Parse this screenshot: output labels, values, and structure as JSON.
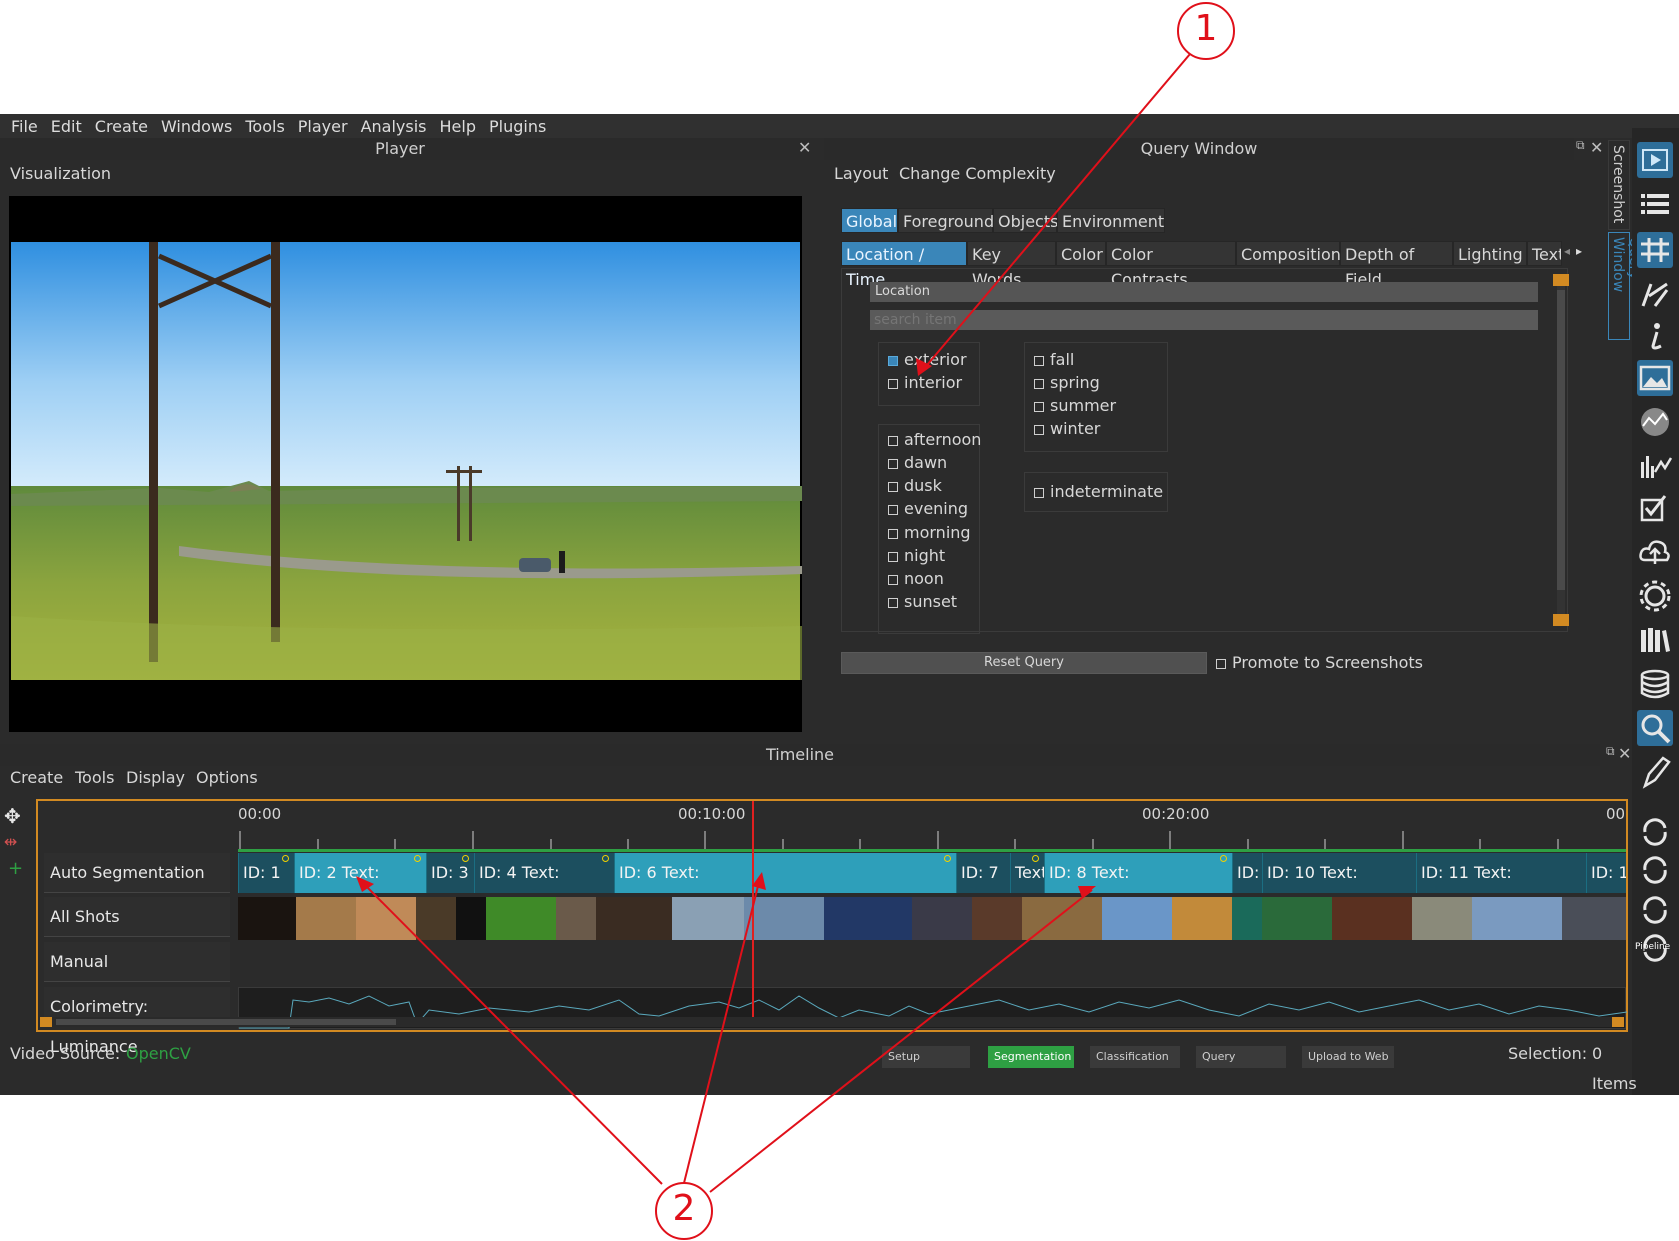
{
  "menu": [
    "File",
    "Edit",
    "Create",
    "Windows",
    "Tools",
    "Player",
    "Analysis",
    "Help",
    "Plugins"
  ],
  "player": {
    "title": "Player",
    "visualization_label": "Visualization"
  },
  "query": {
    "title": "Query Window",
    "menu": [
      "Layout",
      "Change Complexity"
    ],
    "tabs_top": [
      "Global",
      "Foreground",
      "Objects",
      "Environment"
    ],
    "tabs_sub": [
      "Location / Time",
      "Key Words",
      "Color",
      "Color Contrasts",
      "Composition",
      "Depth of Field",
      "Lighting",
      "Text"
    ],
    "location_header": "Location",
    "search_placeholder": "search item",
    "group1": [
      {
        "label": "exterior",
        "checked": true
      },
      {
        "label": "interior",
        "checked": false
      }
    ],
    "group2": [
      {
        "label": "afternoon"
      },
      {
        "label": "dawn"
      },
      {
        "label": "dusk"
      },
      {
        "label": "evening"
      },
      {
        "label": "morning"
      },
      {
        "label": "night"
      },
      {
        "label": "noon"
      },
      {
        "label": "sunset"
      }
    ],
    "group3": [
      {
        "label": "fall"
      },
      {
        "label": "spring"
      },
      {
        "label": "summer"
      },
      {
        "label": "winter"
      }
    ],
    "group4": [
      {
        "label": "indeterminate"
      }
    ],
    "reset_button": "Reset Query",
    "promote_label": "Promote to Screenshots"
  },
  "side_tabs": [
    "Screenshot",
    "Query Window"
  ],
  "timeline": {
    "title": "Timeline",
    "menu": [
      "Create",
      "Tools",
      "Display",
      "Options"
    ],
    "time_labels": [
      "00:00",
      "00:10:00",
      "00:20:00",
      "00"
    ],
    "tracks": [
      "Auto Segmentation",
      "All Shots",
      "Manual",
      "Colorimetry: Luminance"
    ],
    "segments": [
      "ID: 1",
      "ID: 2    Text:",
      "ID: 3",
      "ID: 4     Text:",
      "ID: 6     Text:",
      "ID: 7",
      "Text",
      "ID: 8     Text:",
      "ID:",
      "ID: 10    Text:",
      "ID: 11    Text:",
      "ID: 1"
    ]
  },
  "status": {
    "video_source_label": "Video Source:",
    "video_source_value": "OpenCV",
    "pipeline": [
      "Setup",
      "Segmentation",
      "Classification",
      "Query",
      "Upload to Web"
    ],
    "pipeline_active": "Segmentation",
    "selection_label": "Selection:",
    "selection_value": "0 Items"
  },
  "toolbar_icons": [
    "player-icon",
    "list-icon",
    "timeline-icon",
    "annotation-icon",
    "info-icon",
    "image-icon",
    "colorimetry-icon",
    "chart-icon",
    "checklist-icon",
    "upload-cloud-icon",
    "settings-gear-icon",
    "library-icon",
    "database-icon",
    "search-icon",
    "pen-icon",
    "sync-icon",
    "refresh-icon",
    "pipeline-icon"
  ],
  "pipeline_icon_label": "Pipeline",
  "callouts": [
    "1",
    "2"
  ],
  "colors": {
    "accent": "#3a86b9",
    "segment": "#2e9fba",
    "timeline_border": "#d28a22",
    "pipeline_active": "#2ea043",
    "callout": "#e0101a"
  }
}
